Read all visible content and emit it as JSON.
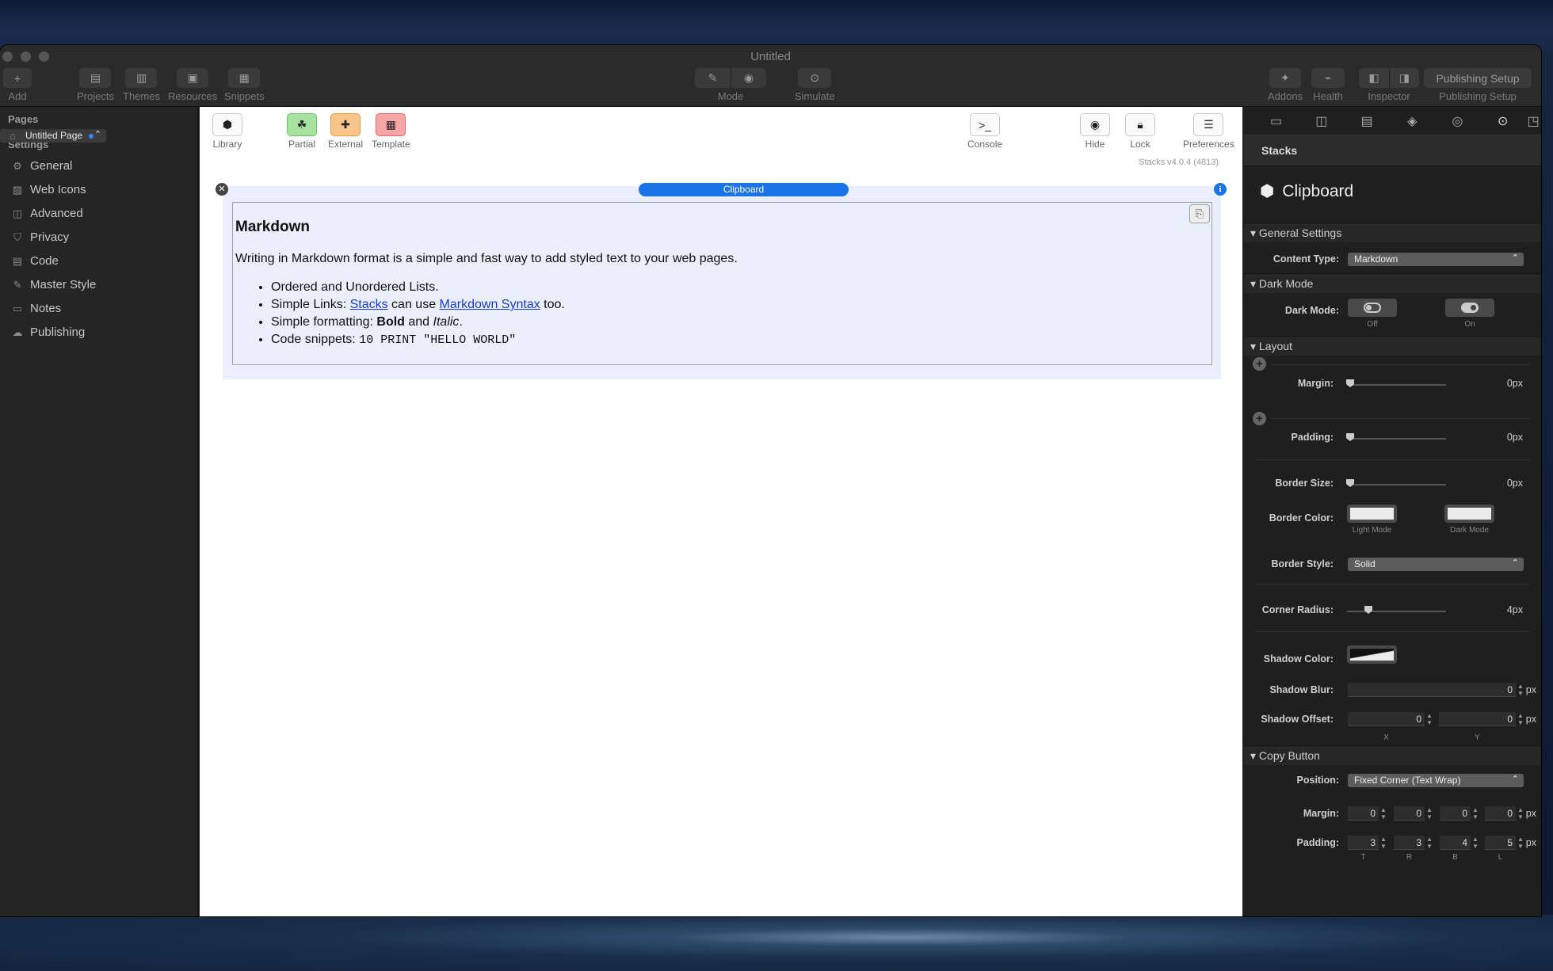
{
  "window": {
    "title": "Untitled"
  },
  "toolbar": {
    "add": "Add",
    "projects": "Projects",
    "themes": "Themes",
    "resources": "Resources",
    "snippets": "Snippets",
    "mode": "Mode",
    "simulate": "Simulate",
    "addons": "Addons",
    "health": "Health",
    "inspector": "Inspector",
    "publishing_setup_btn": "Publishing Setup",
    "publishing_setup": "Publishing Setup"
  },
  "sidebar": {
    "pages_header": "Pages",
    "page": "Untitled Page",
    "settings_header": "Settings",
    "items": [
      {
        "label": "General",
        "icon": "gear-icon"
      },
      {
        "label": "Web Icons",
        "icon": "image-icon"
      },
      {
        "label": "Advanced",
        "icon": "advanced-icon"
      },
      {
        "label": "Privacy",
        "icon": "shield-icon"
      },
      {
        "label": "Code",
        "icon": "code-icon"
      },
      {
        "label": "Master Style",
        "icon": "brush-icon"
      },
      {
        "label": "Notes",
        "icon": "notes-icon"
      },
      {
        "label": "Publishing",
        "icon": "cloud-icon"
      }
    ]
  },
  "stacks_toolbar": {
    "library": "Library",
    "partial": "Partial",
    "external": "External",
    "template": "Template",
    "console": "Console",
    "hide": "Hide",
    "lock": "Lock",
    "preferences": "Preferences",
    "version": "Stacks v4.0.4 (4813)"
  },
  "stack": {
    "label": "Clipboard",
    "heading": "Markdown",
    "intro": "Writing in Markdown format is a simple and fast way to add styled text to your web pages.",
    "li1": "Ordered and Unordered Lists.",
    "li2_a": "Simple Links: ",
    "li2_link1": "Stacks",
    "li2_b": " can use ",
    "li2_link2": "Markdown Syntax",
    "li2_c": " too.",
    "li3_a": "Simple formatting: ",
    "li3_bold": "Bold",
    "li3_b": " and ",
    "li3_italic": "Italic",
    "li3_c": ".",
    "li4_a": "Code snippets: ",
    "li4_code": "10 PRINT \"HELLO WORLD\""
  },
  "inspector": {
    "header": "Stacks",
    "title": "Clipboard",
    "general_settings": "General Settings",
    "content_type_label": "Content Type:",
    "content_type": "Markdown",
    "dark_mode_section": "Dark Mode",
    "dark_mode_label": "Dark Mode:",
    "off": "Off",
    "on": "On",
    "layout_section": "Layout",
    "margin_label": "Margin:",
    "margin": "0px",
    "padding_label": "Padding:",
    "padding": "0px",
    "border_size_label": "Border Size:",
    "border_size": "0px",
    "border_color_label": "Border Color:",
    "light_mode": "Light Mode",
    "dark_mode": "Dark Mode",
    "border_style_label": "Border Style:",
    "border_style": "Solid",
    "corner_radius_label": "Corner Radius:",
    "corner_radius": "4px",
    "shadow_color_label": "Shadow Color:",
    "shadow_blur_label": "Shadow Blur:",
    "shadow_blur": "0",
    "shadow_offset_label": "Shadow Offset:",
    "shadow_offset_x": "0",
    "shadow_offset_y": "0",
    "px": "px",
    "x": "X",
    "y": "Y",
    "copy_button_section": "Copy Button",
    "position_label": "Position:",
    "position": "Fixed Corner (Text Wrap)",
    "cb_margin_label": "Margin:",
    "cb_margin": [
      "0",
      "0",
      "0",
      "0"
    ],
    "cb_padding_label": "Padding:",
    "cb_padding": [
      "3",
      "3",
      "4",
      "5"
    ],
    "trbl": [
      "T",
      "R",
      "B",
      "L"
    ]
  }
}
